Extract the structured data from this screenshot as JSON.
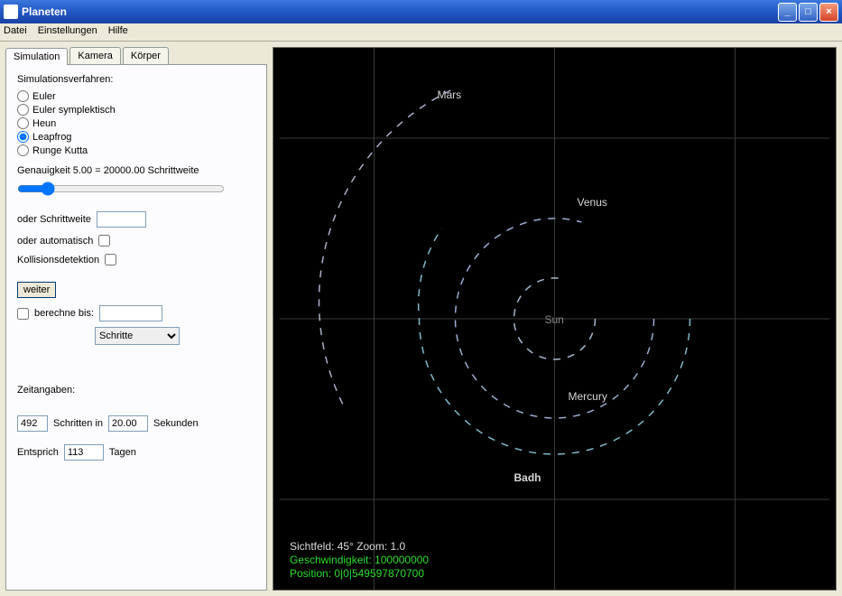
{
  "window": {
    "title": "Planeten"
  },
  "menu": {
    "items": [
      "Datei",
      "Einstellungen",
      "Hilfe"
    ]
  },
  "tabs": {
    "items": [
      "Simulation",
      "Kamera",
      "Körper"
    ],
    "active": 0
  },
  "sim": {
    "verfahren_label": "Simulationsverfahren:",
    "methods": [
      "Euler",
      "Euler symplektisch",
      "Heun",
      "Leapfrog",
      "Runge Kutta"
    ],
    "selected_method": "Leapfrog",
    "accuracy_label": "Genauigkeit  5.00 = 20000.00 Schrittweite",
    "oder_schrittweite": "oder Schrittweite",
    "schrittweite_value": "",
    "oder_automatisch": "oder automatisch",
    "kollision": "Kollisionsdetektion",
    "weiter": "weiter",
    "berechne_bis": "berechne bis:",
    "berechne_value": "",
    "unit_options": [
      "Schritte"
    ],
    "unit_selected": "Schritte",
    "zeitangaben": "Zeitangaben:",
    "steps_value": "492",
    "schritten_in": "Schritten in",
    "seconds_value": "20.00",
    "sekunden": "Sekunden",
    "entspricht": "Entsprich",
    "days_value": "113",
    "tagen": "Tagen"
  },
  "viewport": {
    "bodies": {
      "sun": "Sun",
      "mercury": "Mercury",
      "venus": "Venus",
      "mars": "Mars",
      "earth_moon": "Badh"
    },
    "status": {
      "fov": "Sichtfeld: 45° Zoom: 1.0",
      "speed": "Geschwindigkeit: 100000000",
      "pos": "Position: 0|0|549597870700"
    }
  }
}
